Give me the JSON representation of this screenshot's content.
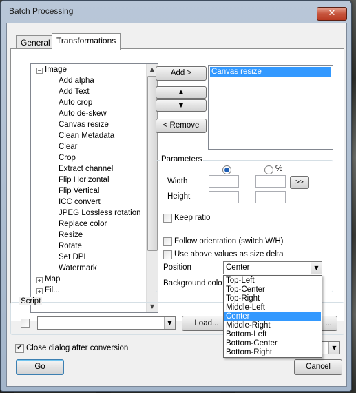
{
  "window": {
    "title": "Batch Processing",
    "close_glyph": "✕"
  },
  "tabs": [
    {
      "label": "General",
      "active": false
    },
    {
      "label": "Transformations",
      "active": true
    }
  ],
  "tree": {
    "root_image": "Image",
    "items": [
      "Add alpha",
      "Add Text",
      "Auto crop",
      "Auto de-skew",
      "Canvas resize",
      "Clean Metadata",
      "Clear",
      "Crop",
      "Extract channel",
      "Flip Horizontal",
      "Flip Vertical",
      "ICC convert",
      "JPEG Lossless rotation",
      "Replace color",
      "Resize",
      "Rotate",
      "Set DPI",
      "Watermark"
    ],
    "root_map": "Map",
    "root_partial": "Fil..."
  },
  "buttons": {
    "add": "Add >",
    "remove": "< Remove",
    "arrows": ">>",
    "load": "Load...",
    "go": "Go",
    "cancel": "Cancel",
    "ellipsis": "..."
  },
  "transform_list": [
    "Canvas resize"
  ],
  "parameters": {
    "group_label": "Parameters",
    "percent_label": "%",
    "width_label": "Width",
    "height_label": "Height",
    "keep_ratio": "Keep ratio",
    "follow_orientation": "Follow orientation (switch W/H)",
    "size_delta": "Use above values as size delta",
    "position_label": "Position",
    "position_value": "Center",
    "background_label": "Background colo"
  },
  "position_options": [
    "Top-Left",
    "Top-Center",
    "Top-Right",
    "Middle-Left",
    "Center",
    "Middle-Right",
    "Bottom-Left",
    "Bottom-Center",
    "Bottom-Right"
  ],
  "position_selected_index": 4,
  "script": {
    "label": "Script",
    "value": ""
  },
  "close_dialog": {
    "label": "Close dialog after conversion",
    "checked": true
  },
  "icons": {
    "expand": "+",
    "collapse": "−",
    "up": "▲",
    "down": "▼"
  }
}
